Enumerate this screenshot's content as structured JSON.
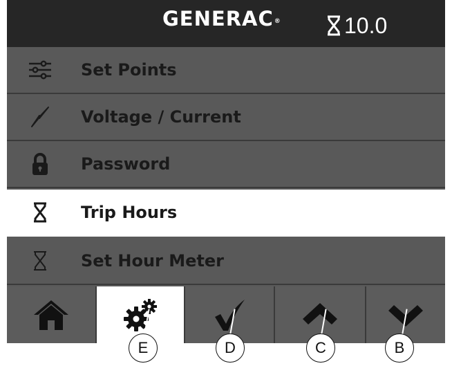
{
  "header": {
    "brand": "GENERAC",
    "brand_mark": "®",
    "timer_icon": "hourglass-icon",
    "timer_value": "10.0"
  },
  "menu": {
    "items": [
      {
        "label": "Set Points",
        "icon": "sliders-icon",
        "selected": false
      },
      {
        "label": "Voltage / Current",
        "icon": "lightning-bolt-icon",
        "selected": false
      },
      {
        "label": "Password",
        "icon": "lock-icon",
        "selected": false
      },
      {
        "label": "Trip Hours",
        "icon": "hourglass-icon",
        "selected": true
      },
      {
        "label": "Set Hour Meter",
        "icon": "hourglass-icon",
        "selected": false
      }
    ]
  },
  "toolbar": {
    "buttons": [
      {
        "icon": "home-icon",
        "active": false
      },
      {
        "icon": "gears-icon",
        "active": true
      },
      {
        "icon": "checkmark-icon",
        "active": false
      },
      {
        "icon": "chevron-up-icon",
        "active": false
      },
      {
        "icon": "chevron-down-icon",
        "active": false
      }
    ]
  },
  "callouts": [
    "E",
    "D",
    "C",
    "B"
  ],
  "colors": {
    "header_bg": "#262626",
    "row_bg": "#595959",
    "selected_bg": "#ffffff",
    "text": "#1a1a1a"
  }
}
